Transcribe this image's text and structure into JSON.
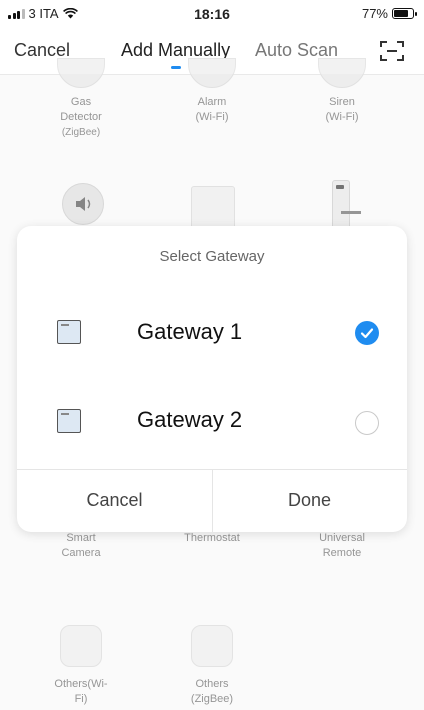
{
  "status_bar": {
    "carrier": "3 ITA",
    "time": "18:16",
    "battery": "77%"
  },
  "nav": {
    "cancel": "Cancel",
    "tabs": [
      "Add Manually",
      "Auto Scan"
    ],
    "scan_icon": "scan-frame-icon"
  },
  "devices_top": [
    {
      "line1": "Gas",
      "line2": "Detector",
      "line3": "(ZigBee)"
    },
    {
      "line1": "Alarm",
      "line2": "(Wi-Fi)"
    },
    {
      "line1": "Siren",
      "line2": "(Wi-Fi)"
    }
  ],
  "devices_mid": [
    {
      "line1": "Smart",
      "line2": "Camera"
    },
    {
      "line1": "Thermostat"
    },
    {
      "line1": "Universal",
      "line2": "Remote"
    }
  ],
  "devices_bottom": [
    {
      "line1": "Others(Wi-",
      "line2": "Fi)"
    },
    {
      "line1": "Others",
      "line2": "(ZigBee)"
    }
  ],
  "dialog": {
    "title": "Select Gateway",
    "gateways": [
      {
        "name": "Gateway 1",
        "selected": true
      },
      {
        "name": "Gateway 2",
        "selected": false
      }
    ],
    "cancel": "Cancel",
    "done": "Done"
  },
  "colors": {
    "accent": "#1f8cf0"
  }
}
